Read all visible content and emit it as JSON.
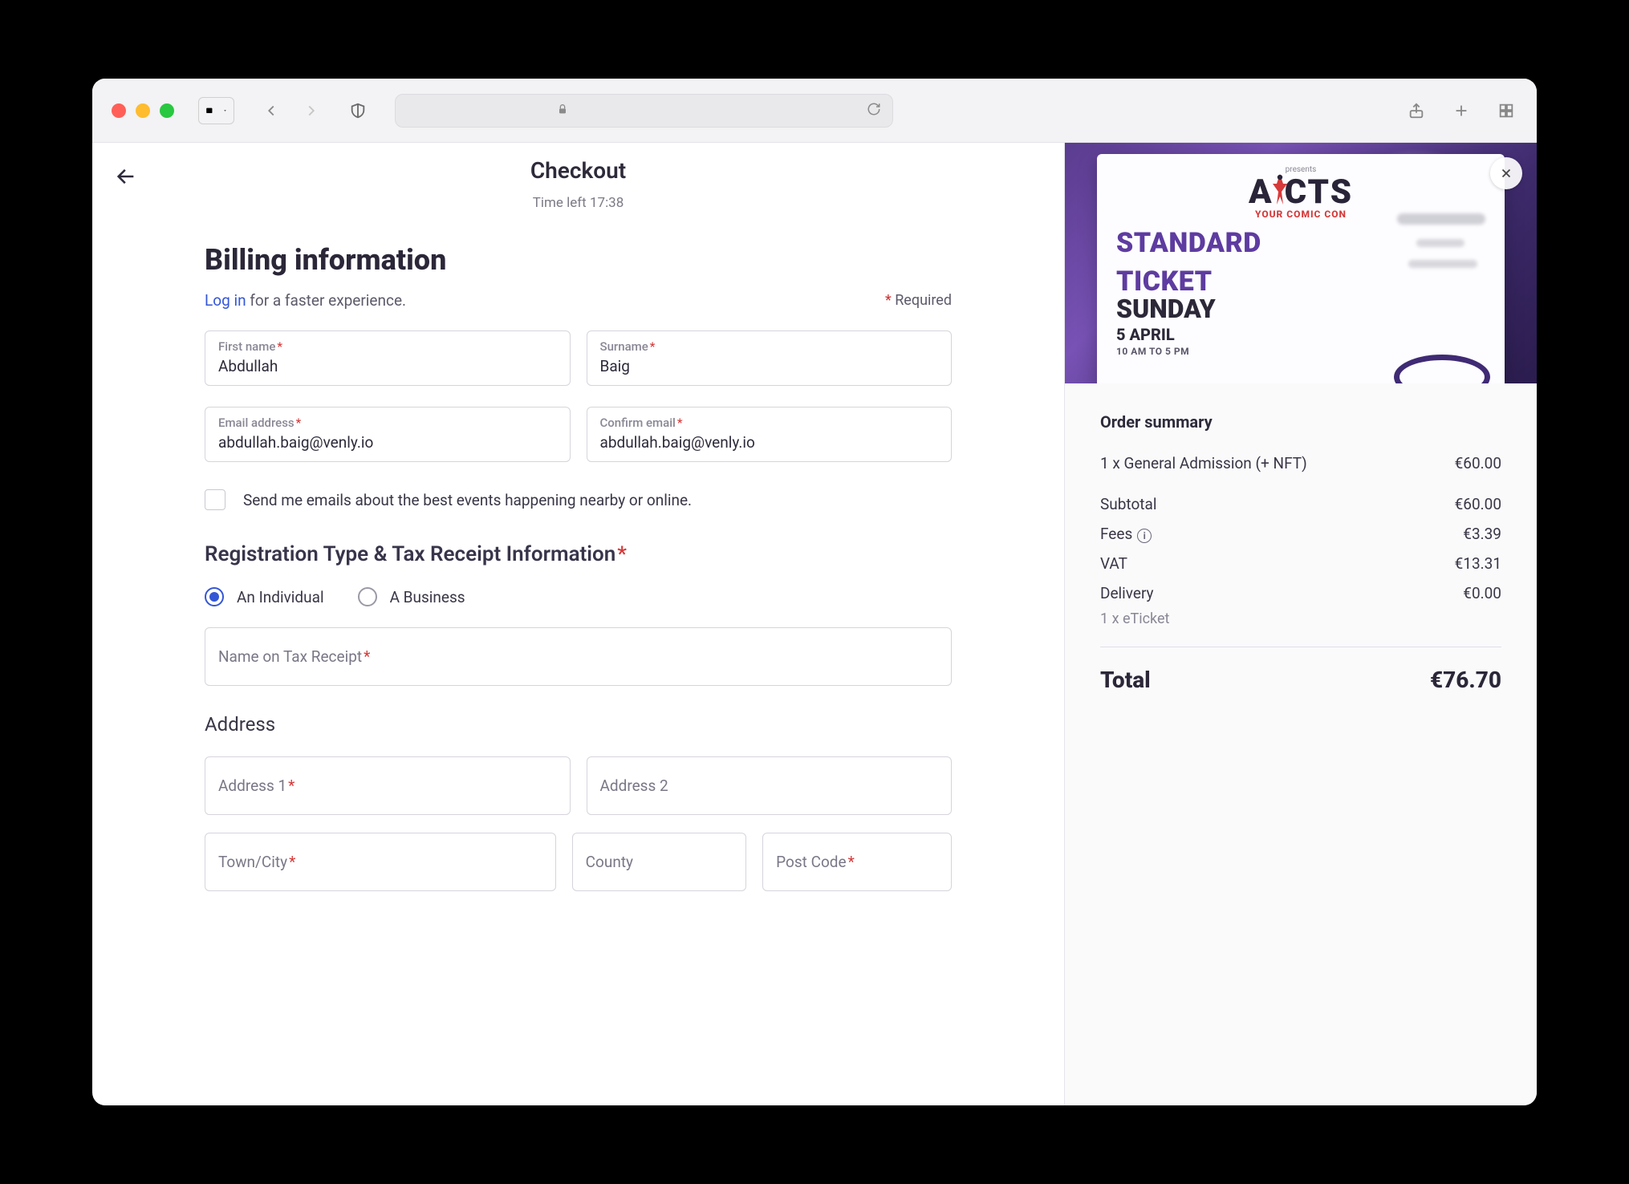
{
  "header": {
    "title": "Checkout",
    "time_left_label": "Time left 17:38"
  },
  "billing": {
    "heading": "Billing information",
    "login_text": "Log in",
    "login_suffix": " for a faster experience.",
    "required_label": " Required",
    "first_name_label": "First name",
    "first_name_value": "Abdullah",
    "surname_label": "Surname",
    "surname_value": "Baig",
    "email_label": "Email address",
    "email_value": "abdullah.baig@venly.io",
    "confirm_email_label": "Confirm email",
    "confirm_email_value": "abdullah.baig@venly.io",
    "optin_label": "Send me emails about the best events happening nearby or online.",
    "reg_heading": "Registration Type & Tax Receipt Information",
    "radio_individual": "An Individual",
    "radio_business": "A Business",
    "tax_receipt_placeholder": "Name on Tax Receipt",
    "address_heading": "Address",
    "address1": "Address 1",
    "address2": "Address 2",
    "town": "Town/City",
    "county": "County",
    "postcode": "Post Code"
  },
  "banner": {
    "presents": "presents",
    "logo_text": "CTS",
    "logo_sub": "YOUR COMIC CON",
    "ticket_line1": "STANDARD",
    "ticket_line2": "TICKET",
    "ticket_day": "SUNDAY",
    "ticket_date": "5 APRIL",
    "ticket_time": "10 AM TO 5 PM"
  },
  "summary": {
    "title": "Order summary",
    "item_label": "1 x General Admission (+ NFT)",
    "item_price": "€60.00",
    "subtotal_label": "Subtotal",
    "subtotal_value": "€60.00",
    "fees_label": "Fees",
    "fees_value": "€3.39",
    "vat_label": "VAT",
    "vat_value": "€13.31",
    "delivery_label": "Delivery",
    "delivery_value": "€0.00",
    "delivery_sub": "1 x eTicket",
    "total_label": "Total",
    "total_value": "€76.70"
  }
}
